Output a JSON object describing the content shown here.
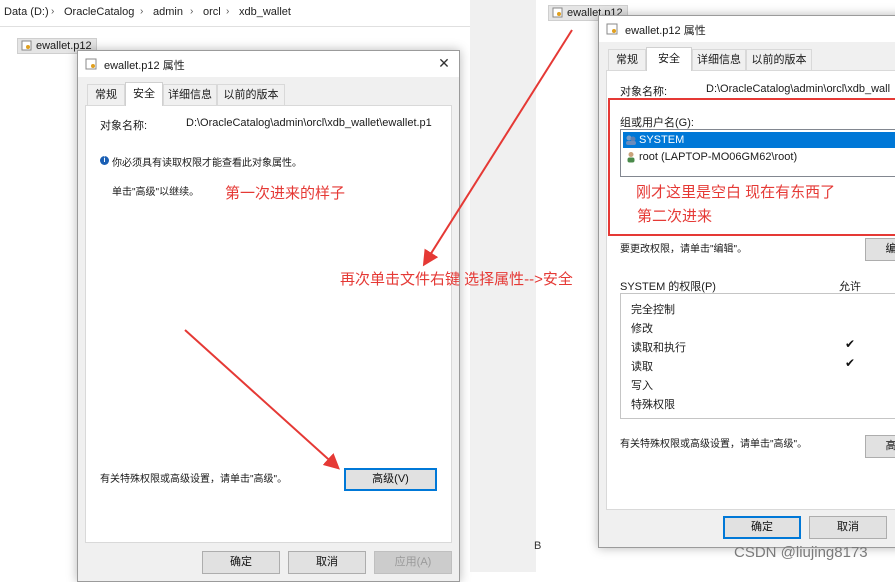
{
  "breadcrumb": [
    "Data (D:)",
    "OracleCatalog",
    "admin",
    "orcl",
    "xdb_wallet"
  ],
  "file_name": "ewallet.p12",
  "dialog1": {
    "title": "ewallet.p12 属性",
    "tabs": [
      "常规",
      "安全",
      "详细信息",
      "以前的版本"
    ],
    "active_tab": "安全",
    "object_label": "对象名称:",
    "object_value": "D:\\OracleCatalog\\admin\\orcl\\xdb_wallet\\ewallet.p1",
    "notice": "你必须具有读取权限才能查看此对象属性。",
    "continue": "单击\"高级\"以继续。",
    "advanced_hint": "有关特殊权限或高级设置，请单击\"高级\"。",
    "advanced_button": "高级(V)",
    "ok": "确定",
    "cancel": "取消",
    "apply": "应用(A)"
  },
  "dialog2": {
    "title": "ewallet.p12 属性",
    "tabs": [
      "常规",
      "安全",
      "详细信息",
      "以前的版本"
    ],
    "active_tab": "安全",
    "object_label": "对象名称:",
    "object_value": "D:\\OracleCatalog\\admin\\orcl\\xdb_wall",
    "group_label": "组或用户名(G):",
    "users": [
      "SYSTEM",
      "root (LAPTOP-MO06GM62\\root)"
    ],
    "edit_hint": "要更改权限，请单击\"编辑\"。",
    "edit_button": "编",
    "perm_title": "SYSTEM 的权限(P)",
    "allow_header": "允许",
    "permissions": [
      {
        "name": "完全控制",
        "allow": false
      },
      {
        "name": "修改",
        "allow": false
      },
      {
        "name": "读取和执行",
        "allow": true
      },
      {
        "name": "读取",
        "allow": true
      },
      {
        "name": "写入",
        "allow": false
      },
      {
        "name": "特殊权限",
        "allow": false
      }
    ],
    "advanced_hint": "有关特殊权限或高级设置，请单击\"高级\"。",
    "advanced_button": "高",
    "ok": "确定",
    "cancel": "取消"
  },
  "annotations": {
    "first_time": "第一次进来的样子",
    "again": "再次单击文件右键 选择属性-->安全",
    "now_filled_1": "刚才这里是空白 现在有东西了",
    "now_filled_2": "第二次进来"
  },
  "watermark": "CSDN @liujing8173",
  "stray_char": "B",
  "colors": {
    "annotation": "#e53935",
    "selection": "#0078d7"
  }
}
